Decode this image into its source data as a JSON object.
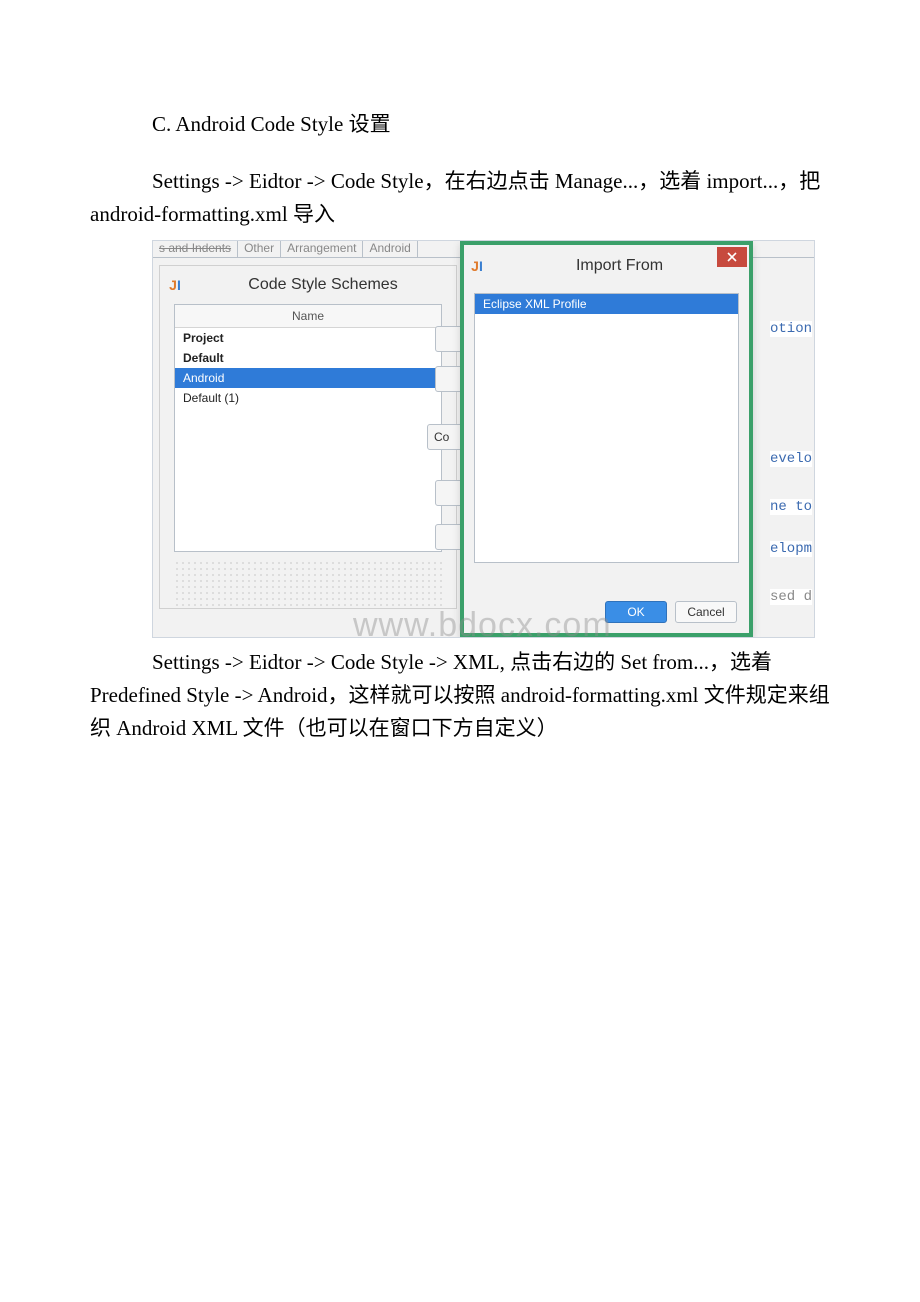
{
  "doc": {
    "heading": "C. Android Code Style 设置",
    "para1": "Settings -> Eidtor -> Code Style，在右边点击 Manage...，选着 import...，把 android-formatting.xml 导入",
    "para2": "Settings -> Eidtor -> Code Style -> XML, 点击右边的 Set from...，选着 Predefined Style -> Android，这样就可以按照 android-formatting.xml 文件规定来组织 Android XML 文件（也可以在窗口下方自定义）"
  },
  "tabs": {
    "t1_fragment": "s and Indents",
    "t2": "Other",
    "t3": "Arrangement",
    "t4": "Android"
  },
  "schemes_modal": {
    "title": "Code Style Schemes",
    "header": "Name",
    "rows": {
      "r0": "Project",
      "r1": "Default",
      "r2": "Android",
      "r3": "Default (1)"
    },
    "co_fragment": "Co"
  },
  "import_modal": {
    "title": "Import From",
    "option": "Eclipse XML Profile",
    "ok": "OK",
    "cancel": "Cancel"
  },
  "code_fragments": {
    "f1": "otion",
    "f2": "evelo",
    "f3": "ne to",
    "f4": "elopm",
    "f5": "sed d"
  },
  "watermark": "www.bdocx.com"
}
